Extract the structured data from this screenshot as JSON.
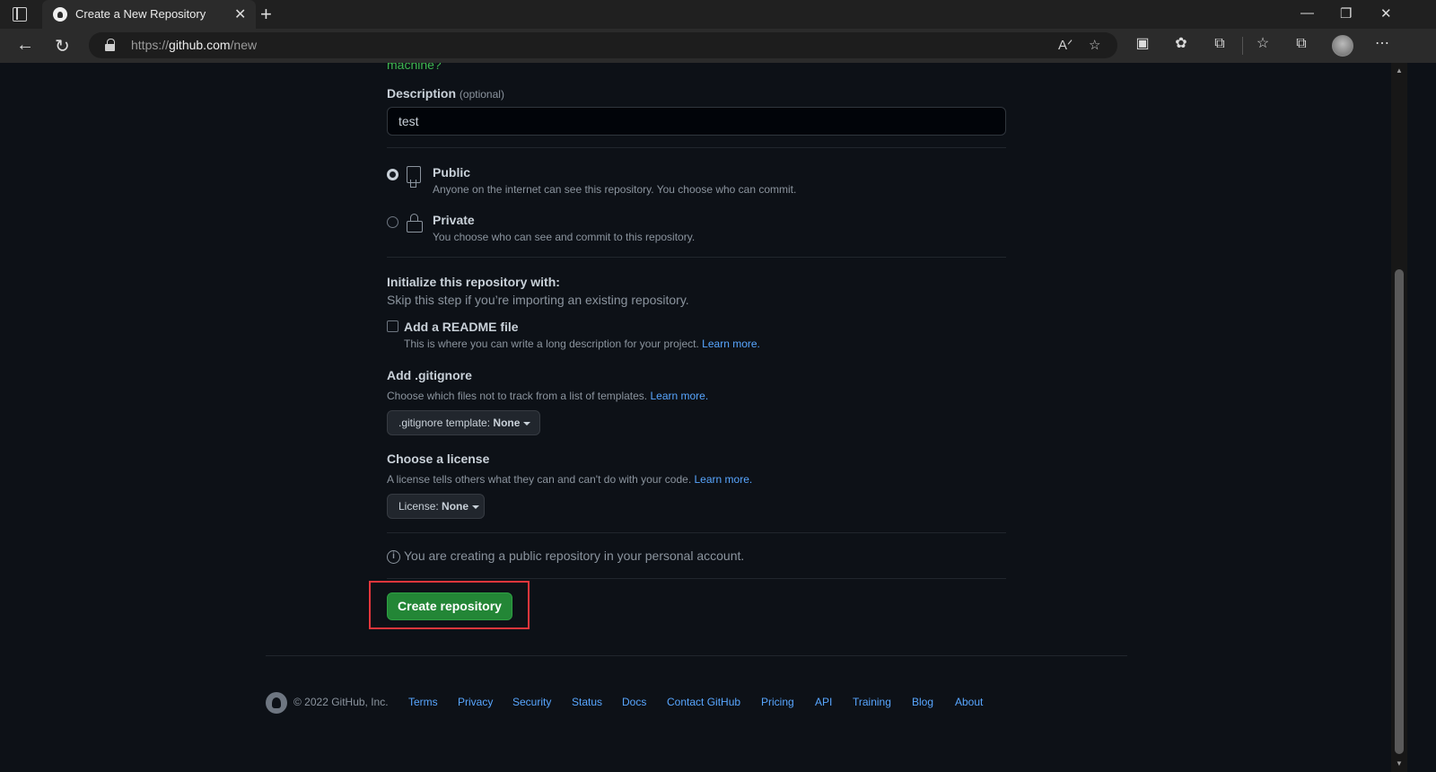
{
  "browser": {
    "tab_title": "Create a New Repository",
    "tab_close": "✕",
    "new_tab": "+",
    "url_prefix": "https://",
    "url_domain": "github.com",
    "url_path": "/new",
    "window_controls": {
      "minimize": "—",
      "restore": "❐",
      "close": "✕"
    }
  },
  "page": {
    "cut_text": "machine?",
    "description": {
      "label": "Description",
      "optional": "(optional)",
      "value": "test"
    },
    "visibility": {
      "selected": "Public",
      "options": [
        {
          "title": "Public",
          "desc": "Anyone on the internet can see this repository. You choose who can commit.",
          "icon": "repo-icon"
        },
        {
          "title": "Private",
          "desc": "You choose who can see and commit to this repository.",
          "icon": "lock-icon"
        }
      ]
    },
    "init": {
      "heading": "Initialize this repository with:",
      "sub": "Skip this step if you’re importing an existing repository.",
      "readme_label": "Add a README file",
      "readme_checked": false,
      "readme_note": "This is where you can write a long description for your project.",
      "learn_more": "Learn more."
    },
    "gitignore": {
      "heading": "Add .gitignore",
      "note": "Choose which files not to track from a list of templates.",
      "learn_more": "Learn more.",
      "dropdown_prefix": ".gitignore template: ",
      "dropdown_value": "None"
    },
    "license": {
      "heading": "Choose a license",
      "note": "A license tells others what they can and can't do with your code.",
      "learn_more": "Learn more.",
      "dropdown_prefix": "License: ",
      "dropdown_value": "None"
    },
    "info_message": "You are creating a public repository in your personal account.",
    "create_button": "Create repository",
    "highlight_color": "#e5363c"
  },
  "footer": {
    "copyright": "© 2022 GitHub, Inc.",
    "links": [
      "Terms",
      "Privacy",
      "Security",
      "Status",
      "Docs",
      "Contact GitHub",
      "Pricing",
      "API",
      "Training",
      "Blog",
      "About"
    ]
  }
}
